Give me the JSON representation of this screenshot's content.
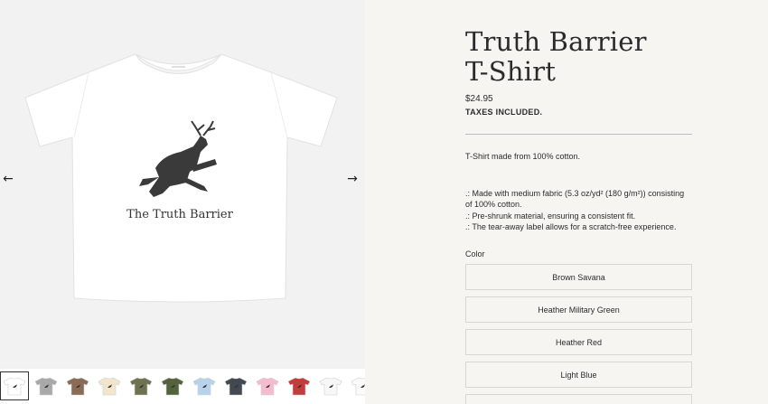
{
  "product": {
    "title_line1": "Truth Barrier",
    "title_line2": "T-Shirt",
    "price": "$24.95",
    "tax_note": "TAXES INCLUDED.",
    "description": "T-Shirt made from 100% cotton.",
    "features": [
      ".: Made with medium fabric (5.3 oz/yd² (180 g/m²)) consisting of 100% cotton.",
      ".: Pre-shrunk material, ensuring a consistent fit.",
      ".: The tear-away label allows for a scratch-free experience."
    ],
    "shirt_print_text": "The Truth Barrier"
  },
  "color_section": {
    "label": "Color",
    "options": [
      "Brown Savana",
      "Heather Military Green",
      "Heather Red",
      "Light Blue"
    ]
  },
  "gallery": {
    "prev_icon": "arrow-left-icon",
    "next_icon": "arrow-right-icon",
    "thumbnails": [
      {
        "color": "#ffffff",
        "active": true
      },
      {
        "color": "#a9a9a9",
        "active": false
      },
      {
        "color": "#8b6b55",
        "active": false
      },
      {
        "color": "#f1e6cc",
        "active": false
      },
      {
        "color": "#6f7250",
        "active": false
      },
      {
        "color": "#55633d",
        "active": false
      },
      {
        "color": "#b7d2ea",
        "active": false
      },
      {
        "color": "#434951",
        "active": false
      },
      {
        "color": "#f5bcd0",
        "active": false
      },
      {
        "color": "#c53a3a",
        "active": false
      },
      {
        "color": "#f7f7f7",
        "active": false
      },
      {
        "color": "#fafafa",
        "active": false
      }
    ]
  },
  "colors": {
    "background_panel": "#f7f5f1",
    "option_border": "#d8d6d2",
    "text": "#2b2b2b"
  }
}
